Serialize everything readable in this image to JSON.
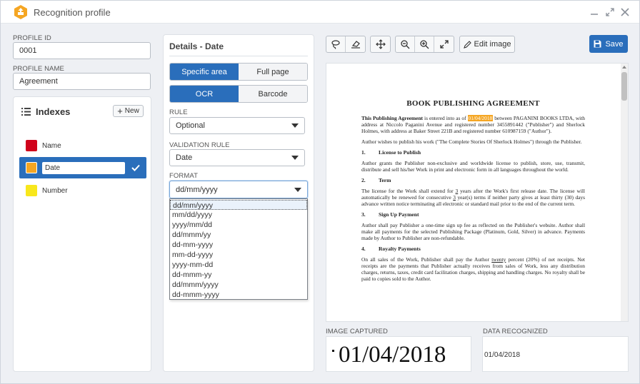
{
  "window": {
    "title": "Recognition profile"
  },
  "profile": {
    "id_label": "PROFILE ID",
    "id_value": "0001",
    "name_label": "PROFILE NAME",
    "name_value": "Agreement"
  },
  "indexes": {
    "title": "Indexes",
    "new_label": "New",
    "items": [
      {
        "label": "Name",
        "color": "#d0021b"
      },
      {
        "label": "Date",
        "color": "#f5a623"
      },
      {
        "label": "Number",
        "color": "#f8e71c"
      }
    ]
  },
  "details": {
    "title": "Details - Date",
    "area_options": [
      "Specific area",
      "Full page"
    ],
    "mode_options": [
      "OCR",
      "Barcode"
    ],
    "rule_label": "RULE",
    "rule_value": "Optional",
    "validation_label": "VALIDATION RULE",
    "validation_value": "Date",
    "format_label": "FORMAT",
    "format_value": "dd/mm/yyyy",
    "format_options": [
      "dd/mm/yyyy",
      "mm/dd/yyyy",
      "yyyy/mm/dd",
      "dd/mmm/yy",
      "dd-mm-yyyy",
      "mm-dd-yyyy",
      "yyyy-mm-dd",
      "dd-mmm-yy",
      "dd/mmm/yyyy",
      "dd-mmm-yyyy"
    ]
  },
  "toolbar": {
    "edit_image_label": "Edit image",
    "save_label": "Save"
  },
  "document": {
    "title": "BOOK PUBLISHING AGREEMENT",
    "intro_bold": "This Publishing Agreement",
    "intro_pre": " is entered into as of ",
    "intro_date": "01/04/2018",
    "intro_post": " between PAGANINI BOOKS LTDA, with address at Niccolo Paganini Avenue and registered number 3455891442 (\"Publisher\") and Sherlock Holmes, with address at Baker Street 221B and registered number 610987159 (\"Author\").",
    "para2": "Author wishes to publish his work (\"The Complete Stories Of Sherlock Holmes\") through the Publisher.",
    "s1_num": "1.",
    "s1_title": "License to Publish",
    "s1_text": "Author grants the Publisher non-exclusive and worldwide license to publish, store, use, transmit, distribute and sell his/her Work in print and electronic form in all languages throughout the world.",
    "s2_num": "2.",
    "s2_title": "Term",
    "s2_text_a": "The license for the Work shall extend for ",
    "s2_u1": "3",
    "s2_text_b": " years after the Work's first release date. The license will automatically be renewed for consecutive ",
    "s2_u2": "3",
    "s2_text_c": " year(s) terms if neither party gives at least thirty (30) days advance written notice terminating all electronic or standard mail prior to the end of the current term.",
    "s3_num": "3.",
    "s3_title": "Sign Up Payment",
    "s3_text": "Author shall pay Publisher a one-time sign up fee as reflected on the Publisher's website. Author shall make all payments for the selected Publishing Package (Platinum, Gold, Silver) in advance. Payments made by Author to Publisher are non-refundable.",
    "s4_num": "4.",
    "s4_title": "Royalty Payments",
    "s4_text_a": "On all sales of the Work, Publisher shall pay the Author ",
    "s4_u": "twenty",
    "s4_text_b": " percent (20%) of net receipts. Net receipts are the payments that Publisher actually receives from sales of Work, less any distribution charges, returns, taxes, credit card facilitation charges, shipping and handling charges. No royalty shall be paid to copies sold to the Author."
  },
  "captured": {
    "label": "IMAGE CAPTURED",
    "value": "01/04/2018"
  },
  "recognized": {
    "label": "DATA RECOGNIZED",
    "value": "01/04/2018"
  },
  "colors": {
    "accent": "#2a6ebb",
    "highlight": "#f5a623"
  }
}
